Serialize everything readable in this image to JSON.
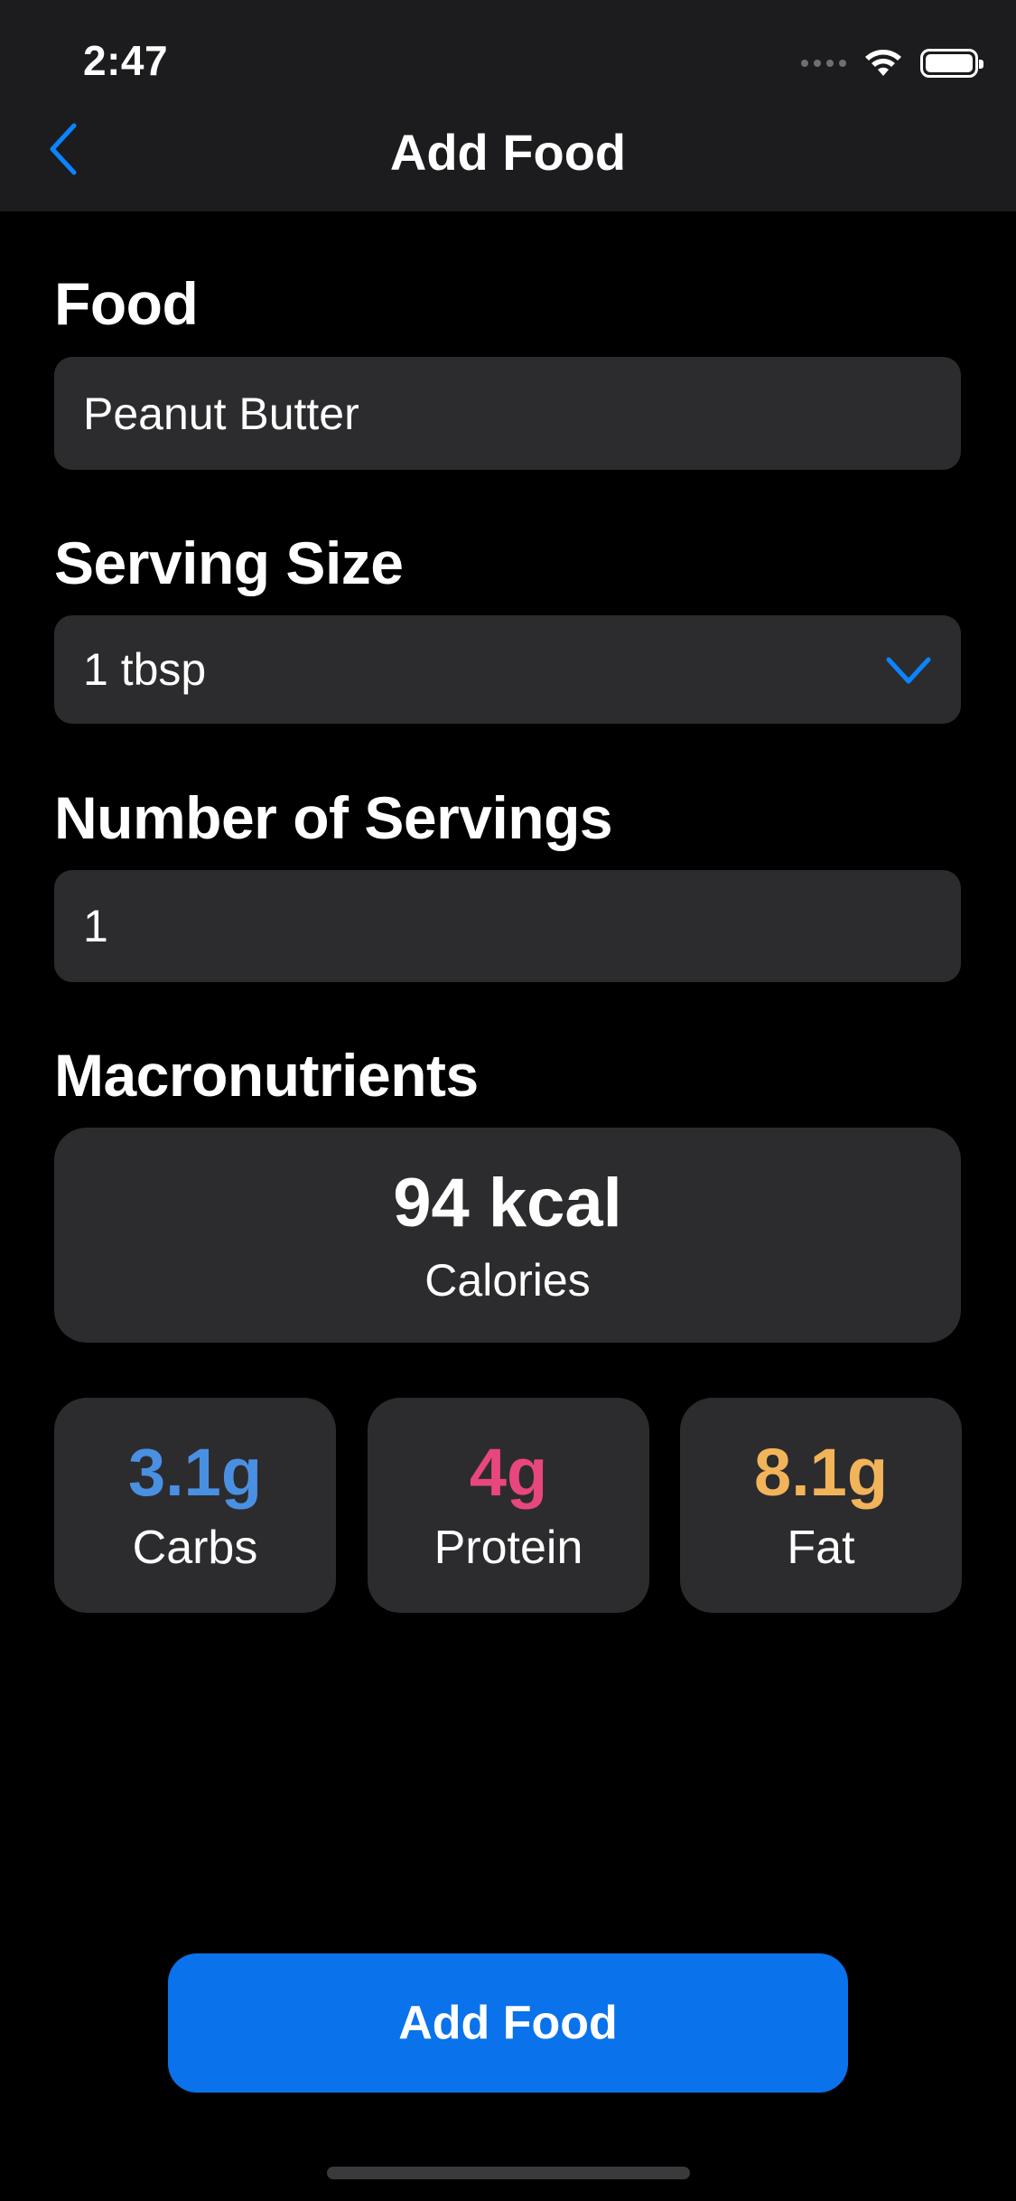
{
  "status_bar": {
    "time": "2:47",
    "signal_icon": "cellular-dots-icon",
    "wifi_icon": "wifi-icon",
    "battery_icon": "battery-full-icon"
  },
  "nav": {
    "back_icon": "chevron-left-icon",
    "title": "Add Food"
  },
  "form": {
    "food": {
      "label": "Food",
      "value": "Peanut Butter"
    },
    "serving_size": {
      "label": "Serving Size",
      "value": "1 tbsp",
      "dropdown_icon": "chevron-down-icon"
    },
    "servings": {
      "label": "Number of Servings",
      "value": "1"
    }
  },
  "macros": {
    "section_label": "Macronutrients",
    "calories": {
      "value": "94 kcal",
      "label": "Calories"
    },
    "carbs": {
      "value": "3.1g",
      "label": "Carbs"
    },
    "protein": {
      "value": "4g",
      "label": "Protein"
    },
    "fat": {
      "value": "8.1g",
      "label": "Fat"
    }
  },
  "actions": {
    "add_label": "Add Food"
  },
  "colors": {
    "accent": "#0a72ea",
    "back_chevron": "#0a84ff",
    "carbs": "#4a90e2",
    "protein": "#e8477e",
    "fat": "#f2b45a",
    "field_bg": "#2c2c2e",
    "nav_bg": "#1c1c1e"
  }
}
